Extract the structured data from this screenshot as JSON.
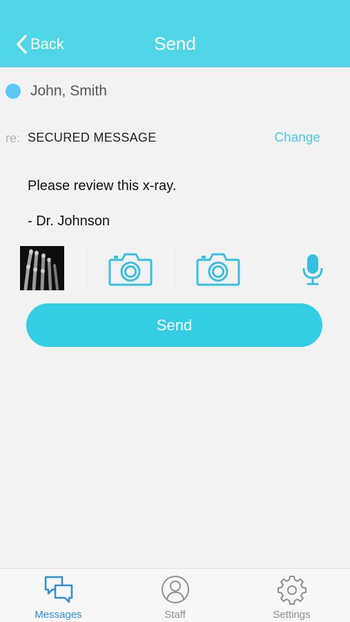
{
  "header": {
    "back_label": "Back",
    "title": "Send",
    "background_color": "#4fd6e8"
  },
  "recipient": {
    "name": "John, Smith",
    "status_color": "#5ac8fa"
  },
  "subject": {
    "prefix": "re:",
    "text": "SECURED MESSAGE",
    "change_label": "Change"
  },
  "message": {
    "line1": "Please review this x-ray.",
    "line2": "- Dr. Johnson"
  },
  "attachments": {
    "items": [
      {
        "type": "image-thumbnail",
        "icon": "xray-thumbnail"
      },
      {
        "type": "camera",
        "icon": "camera-icon"
      },
      {
        "type": "camera",
        "icon": "camera-icon"
      },
      {
        "type": "audio",
        "icon": "microphone-icon"
      }
    ]
  },
  "send_button": {
    "label": "Send",
    "color": "#33cee3"
  },
  "tabbar": {
    "items": [
      {
        "label": "Messages",
        "icon": "messages-icon",
        "active": true
      },
      {
        "label": "Staff",
        "icon": "person-icon",
        "active": false
      },
      {
        "label": "Settings",
        "icon": "gear-icon",
        "active": false
      }
    ],
    "active_color": "#2f8ed8"
  }
}
